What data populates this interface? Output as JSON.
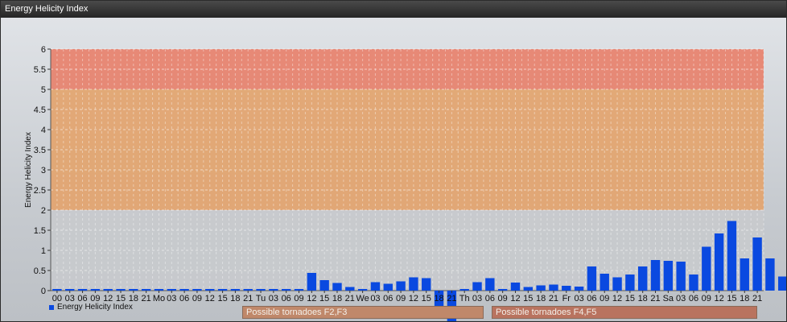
{
  "window": {
    "title": "Energy Helicity Index"
  },
  "colors": {
    "bar": "#0a49e0",
    "zone_low": "#c8cacd",
    "zone_mid": "#e3a36c",
    "zone_high": "#e8806a",
    "band_1": "#c0886a",
    "band_2": "#b9735f"
  },
  "zones": [
    {
      "from": 0,
      "to": 2,
      "color": "#c8cacd"
    },
    {
      "from": 2,
      "to": 5,
      "color": "#e3a36c"
    },
    {
      "from": 5,
      "to": 6,
      "color": "#e8806a"
    }
  ],
  "bands": [
    {
      "label": "Possible tornadoes F2,F3"
    },
    {
      "label": "Possible tornadoes F4,F5"
    }
  ],
  "chart_data": {
    "type": "bar",
    "title": "",
    "ylabel": "Energy Helicity Index",
    "ylim": [
      0,
      6
    ],
    "yticks": [
      "0",
      "0.5",
      "1",
      "1.5",
      "2",
      "2.5",
      "3",
      "3.5",
      "4",
      "4.5",
      "5",
      "5.5",
      "6"
    ],
    "legend": {
      "label": "Energy Helicity Index",
      "position": "bottom-left"
    },
    "grid": true,
    "categories": [
      "00",
      "03",
      "06",
      "09",
      "12",
      "15",
      "18",
      "21",
      "Mo",
      "03",
      "06",
      "09",
      "12",
      "15",
      "18",
      "21",
      "Tu",
      "03",
      "06",
      "09",
      "12",
      "15",
      "18",
      "21",
      "We",
      "03",
      "06",
      "09",
      "12",
      "15",
      "18",
      "21",
      "Th",
      "03",
      "06",
      "09",
      "12",
      "15",
      "18",
      "21",
      "Fr",
      "03",
      "06",
      "09",
      "12",
      "15",
      "18",
      "21",
      "Sa",
      "03",
      "06",
      "09",
      "12",
      "15",
      "18",
      "21"
    ],
    "series": [
      {
        "name": "Energy Helicity Index",
        "values": [
          0.01,
          0.02,
          0.02,
          0.02,
          0.02,
          0.02,
          0.02,
          0.02,
          0.02,
          0.02,
          0.02,
          0.02,
          0.02,
          0.02,
          0.02,
          0.01,
          0.02,
          0.02,
          0.01,
          0.01,
          0.44,
          0.26,
          0.19,
          0.09,
          0.04,
          0.21,
          0.17,
          0.23,
          0.33,
          0.31,
          -0.4,
          -0.8,
          0.02,
          0.21,
          0.31,
          0.02,
          0.2,
          0.09,
          0.13,
          0.15,
          0.12,
          0.1,
          0.6,
          0.42,
          0.33,
          0.4,
          0.6,
          0.76,
          0.74,
          0.72,
          0.4,
          1.09,
          1.42,
          1.73,
          0.8,
          1.32,
          0.8,
          0.35
        ]
      }
    ]
  }
}
